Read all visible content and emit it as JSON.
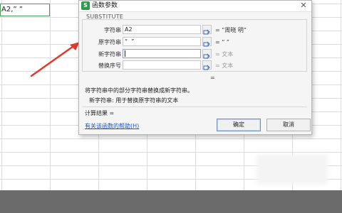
{
  "sheet": {
    "active_cell_text": "A2,” ”"
  },
  "dialog": {
    "title": "函数参数",
    "app_icon_glyph": "S",
    "close_glyph": "✕",
    "function_name": "SUBSTITUTE",
    "args": [
      {
        "label": "字符串",
        "value": "A2",
        "result": "= “周晓    明”",
        "result_is_hint": false
      },
      {
        "label": "原字符串",
        "value": "“  ”",
        "result": "= “  ”",
        "result_is_hint": false
      },
      {
        "label": "新字符串",
        "value": "",
        "result": "= 文本",
        "result_is_hint": true
      },
      {
        "label": "替换序号",
        "value": "",
        "result": "= 文本",
        "result_is_hint": true
      }
    ],
    "overall_equals": "=",
    "description": "将字符串中的部分字符串替换成新字符串。",
    "arg_description": "新字符串: 用于替换原字符串的文本",
    "calc_result_label": "计算结果 =",
    "help_link": "有关该函数的帮助(H)",
    "ok_label": "确定",
    "cancel_label": "取消"
  },
  "colors": {
    "accent_green": "#2e9a4c",
    "annotation_arrow": "#e03a2c",
    "link_blue": "#1a56c8"
  },
  "icons": {
    "app": "spreadsheet-app-icon",
    "ref_button": "collapse-dialog-icon",
    "close": "close-icon"
  }
}
